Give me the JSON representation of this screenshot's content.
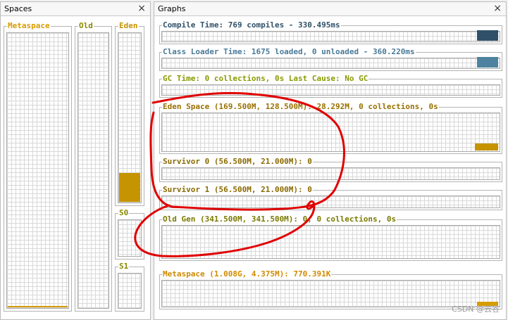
{
  "spaces_panel": {
    "title": "Spaces",
    "close_symbol": "×",
    "metaspace": {
      "label": "Metaspace",
      "color": "#d89b00",
      "fill_fraction": 0.005
    },
    "old": {
      "label": "Old",
      "color": "#8a8a00",
      "fill_fraction": 0
    },
    "eden": {
      "label": "Eden",
      "color": "#c59400",
      "fill_fraction": 0.17
    },
    "s0": {
      "label": "S0",
      "color": "#8a8a00",
      "fill_fraction": 0
    },
    "s1": {
      "label": "S1",
      "color": "#8a8a00",
      "fill_fraction": 0
    }
  },
  "graphs_panel": {
    "title": "Graphs",
    "close_symbol": "×",
    "compile": {
      "label": "Compile Time: 769 compiles - 330.495ms",
      "color": "#2f5068",
      "fill_color": "#2f5068"
    },
    "classloader": {
      "label": "Class Loader Time: 1675 loaded, 0 unloaded - 360.220ms",
      "color": "#4a7a98",
      "fill_color": "#4e82a0"
    },
    "gc": {
      "label": "GC Time: 0 collections, 0s Last Cause: No GC",
      "color": "#8a9a00"
    },
    "eden": {
      "label": "Eden Space (169.500M, 128.500M): 28.292M, 0 collections, 0s",
      "color": "#9a7000",
      "fill_color": "#c59400"
    },
    "survivor0": {
      "label": "Survivor 0 (56.500M, 21.000M): 0",
      "color": "#8a6a00"
    },
    "survivor1": {
      "label": "Survivor 1 (56.500M, 21.000M): 0",
      "color": "#8a6a00"
    },
    "oldgen": {
      "label": "Old Gen (341.500M, 341.500M): 0, 0 collections, 0s",
      "color": "#7a7a00"
    },
    "metaspace": {
      "label": "Metaspace (1.008G, 4.375M): 770.391K",
      "color": "#d08a00",
      "fill_color": "#d89b00"
    }
  },
  "watermark": "CSDN @云谷",
  "annotation_color": "#e00000"
}
